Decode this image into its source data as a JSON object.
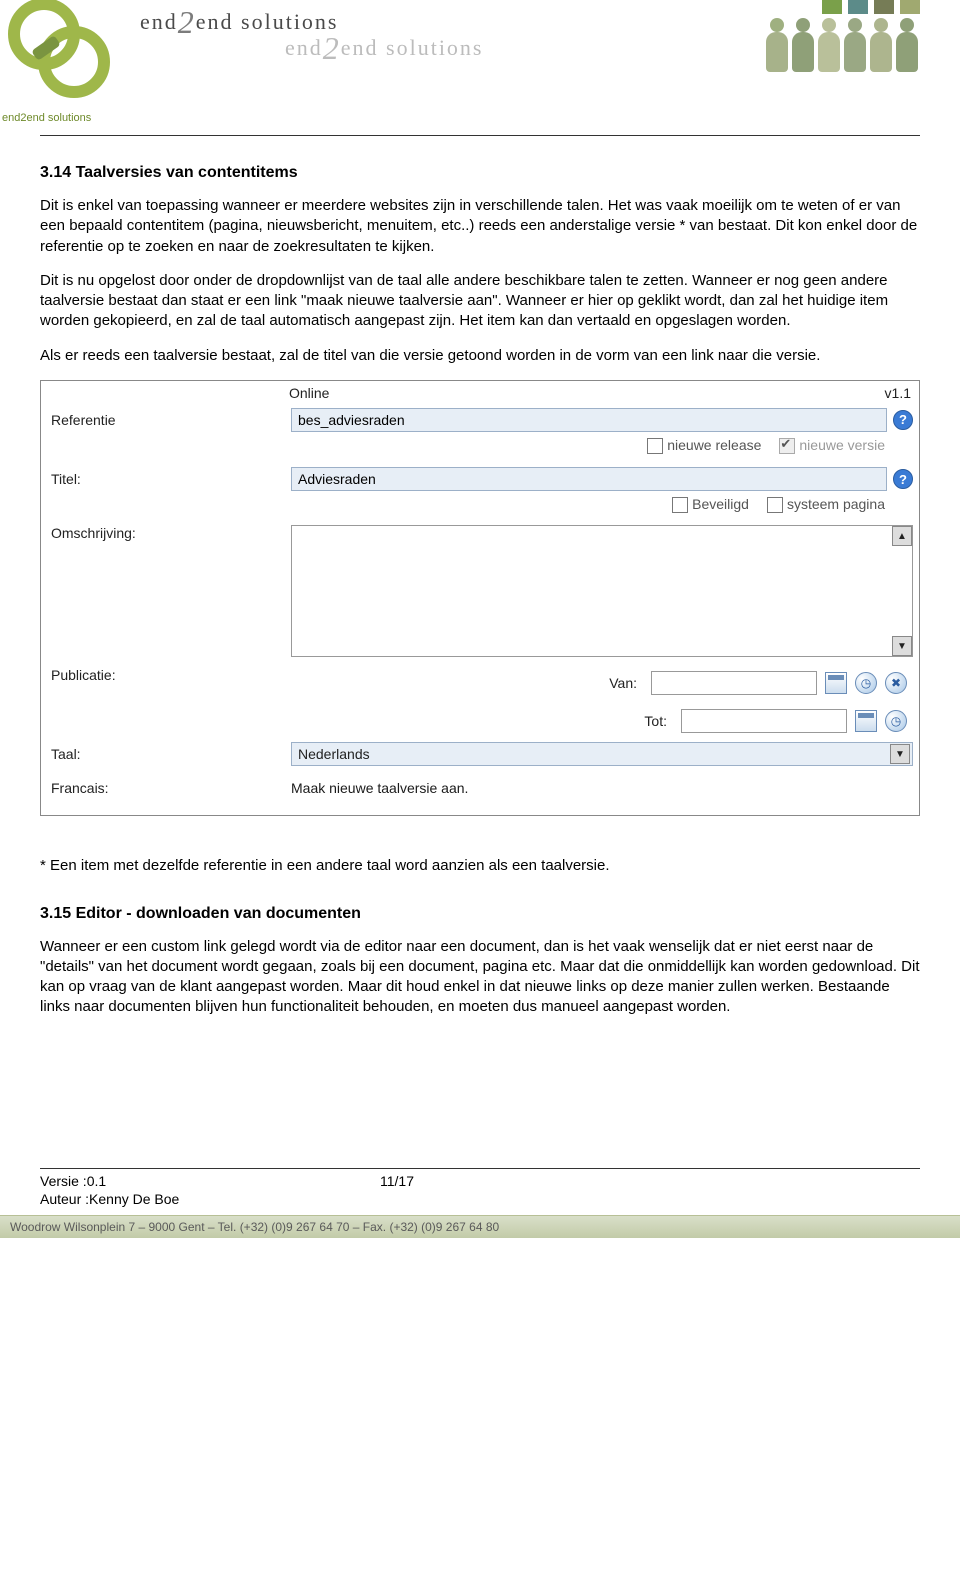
{
  "header": {
    "brand_pre": "end",
    "brand_two": "2",
    "brand_post": "end solutions",
    "logo_label": "end2end solutions"
  },
  "section1": {
    "heading": "3.14 Taalversies van contentitems",
    "p1": "Dit is enkel van toepassing wanneer er meerdere websites zijn in verschillende talen. Het was vaak moeilijk om te weten of er van een bepaald contentitem (pagina, nieuwsbericht, menuitem, etc..) reeds een anderstalige versie * van bestaat. Dit kon enkel door de referentie op te zoeken en naar de zoekresultaten te kijken.",
    "p2": "Dit is nu opgelost door onder de dropdownlijst van de taal alle andere beschikbare talen te zetten. Wanneer er nog geen andere taalversie bestaat dan staat er een link \"maak nieuwe taalversie aan\". Wanneer er hier op geklikt wordt, dan zal het huidige item worden gekopieerd, en zal de taal automatisch aangepast zijn. Het item kan dan vertaald en opgeslagen worden.",
    "p3": "Als er reeds een taalversie bestaat, zal de titel van die versie getoond worden in de vorm van een link naar die versie."
  },
  "form": {
    "status": "Online",
    "version": "v1.1",
    "ref_label": "Referentie",
    "ref_value": "bes_adviesraden",
    "chk_release": "nieuwe release",
    "chk_versie": "nieuwe versie",
    "titel_label": "Titel:",
    "titel_value": "Adviesraden",
    "chk_beveiligd": "Beveiligd",
    "chk_systeem": "systeem pagina",
    "oms_label": "Omschrijving:",
    "pub_label": "Publicatie:",
    "pub_van": "Van:",
    "pub_tot": "Tot:",
    "taal_label": "Taal:",
    "taal_value": "Nederlands",
    "fr_label": "Francais:",
    "fr_link": "Maak nieuwe taalversie aan."
  },
  "note": "* Een item met dezelfde referentie in een andere taal word aanzien als een taalversie.",
  "section2": {
    "heading": "3.15 Editor - downloaden van documenten",
    "p1": "Wanneer er een custom link gelegd wordt via de editor naar een document, dan is het vaak wenselijk dat er niet eerst naar de \"details\" van het document wordt gegaan, zoals bij een document, pagina etc. Maar dat die onmiddellijk kan worden gedownload. Dit kan op vraag van de klant aangepast worden. Maar dit houd enkel in dat nieuwe links op deze manier zullen werken. Bestaande links naar documenten blijven hun functionaliteit behouden, en moeten dus manueel aangepast worden."
  },
  "footer": {
    "versie": "Versie  :0.1",
    "page": "11/17",
    "auteur": "Auteur :Kenny De Boe",
    "address": "Woodrow Wilsonplein 7 – 9000 Gent – Tel. (+32) (0)9 267 64 70 – Fax. (+32) (0)9 267 64 80"
  }
}
